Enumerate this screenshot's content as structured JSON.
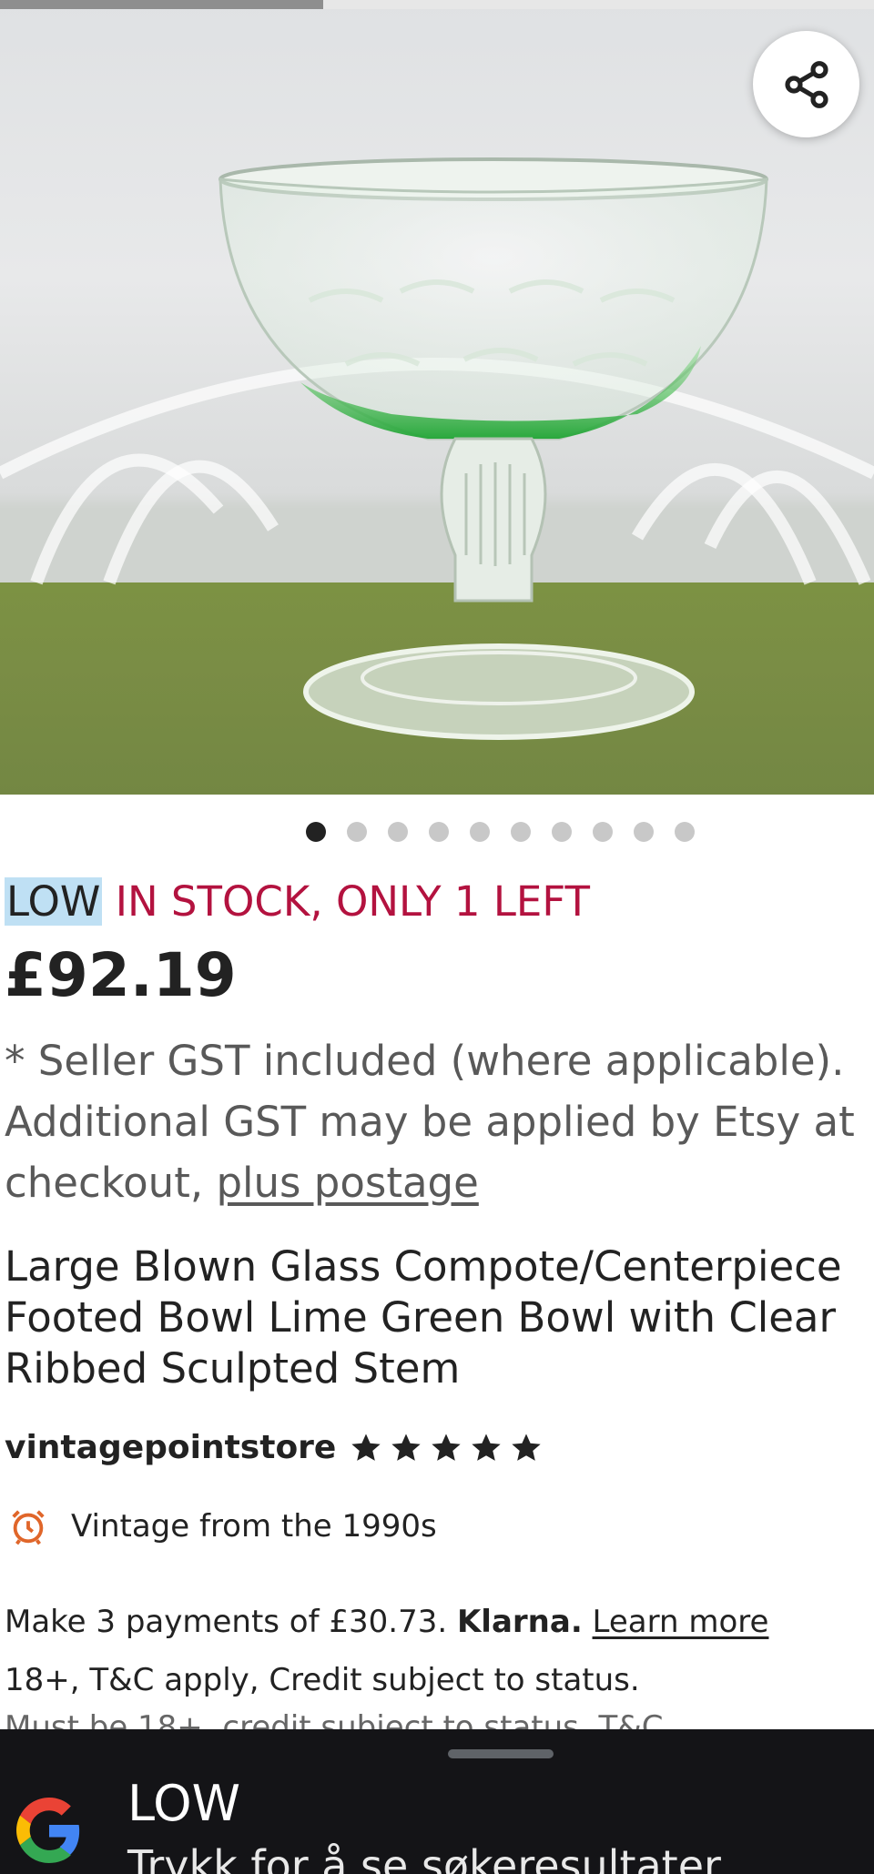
{
  "carousel": {
    "progress_fraction": 0.37,
    "image_count": 10,
    "active_index": 0,
    "share_icon": "share-icon",
    "colors": {
      "glass_green": "#33b53a",
      "table": "#7a8d45",
      "wall": "#e3e4e5"
    }
  },
  "stock": {
    "highlight": "LOW",
    "rest": " IN STOCK, ONLY 1 LEFT",
    "rest_color": "#b3123f",
    "highlight_color": "#bfe0f4"
  },
  "price": "£92.19",
  "tax_note": {
    "text": "* Seller GST included (where applicable). Additional GST may be applied by Etsy at checkout, ",
    "link": "plus postage"
  },
  "title": "Large Blown Glass Compote/Centerpiece Footed Bowl Lime Green Bowl with Clear Ribbed Sculpted Stem",
  "shop": {
    "name": "vintagepointstore",
    "rating_stars": 5
  },
  "vintage": {
    "icon": "alarm-clock-icon",
    "text": "Vintage from the 1990s"
  },
  "klarna": {
    "prefix": "Make 3 payments of £30.73. ",
    "brand": "Klarna.",
    "link": "Learn more",
    "terms": "18+, T&C apply, Credit subject to status.",
    "terms_partial": "Must be 18+, credit subject to status. T&C"
  },
  "google_sheet": {
    "query": "LOW",
    "subtitle": "Trykk for å se søkeresultater"
  }
}
